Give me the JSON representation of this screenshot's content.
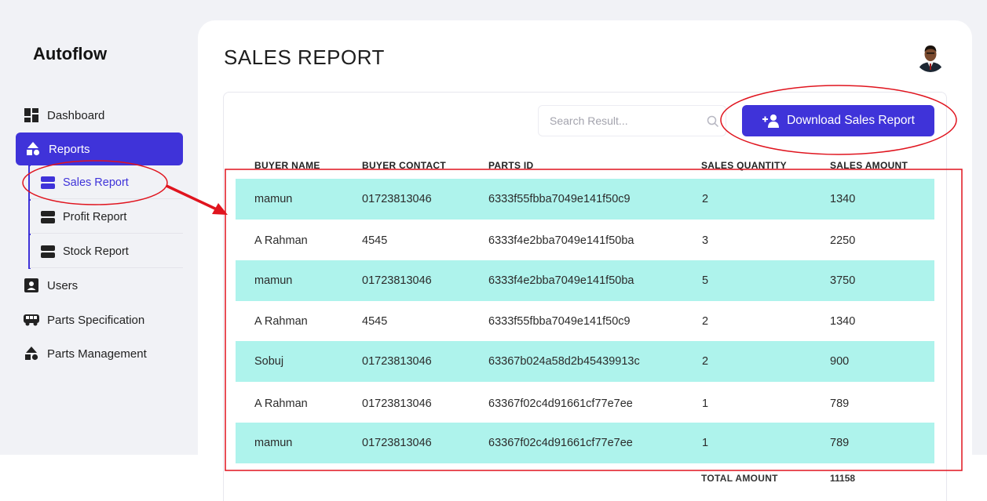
{
  "app": {
    "title": "Autoflow"
  },
  "sidebar": {
    "items": [
      {
        "label": "Dashboard",
        "icon": "dashboard-icon"
      },
      {
        "label": "Reports",
        "icon": "shapes-icon",
        "active": true
      },
      {
        "label": "Users",
        "icon": "user-card-icon"
      },
      {
        "label": "Parts Specification",
        "icon": "bus-icon"
      },
      {
        "label": "Parts Management",
        "icon": "shapes-icon"
      }
    ],
    "subitems": [
      {
        "label": "Sales Report",
        "icon": "report-icon",
        "active": true
      },
      {
        "label": "Profit Report",
        "icon": "report-icon"
      },
      {
        "label": "Stock Report",
        "icon": "report-icon"
      }
    ]
  },
  "page": {
    "title": "SALES REPORT"
  },
  "search": {
    "placeholder": "Search Result..."
  },
  "download_button": {
    "label": "Download Sales Report",
    "icon": "add-user-icon"
  },
  "table": {
    "headers": [
      "BUYER NAME",
      "BUYER CONTACT",
      "PARTS ID",
      "SALES QUANTITY",
      "SALES AMOUNT"
    ],
    "rows": [
      [
        "mamun",
        "01723813046",
        "6333f55fbba7049e141f50c9",
        "2",
        "1340"
      ],
      [
        "A Rahman",
        "4545",
        "6333f4e2bba7049e141f50ba",
        "3",
        "2250"
      ],
      [
        "mamun",
        "01723813046",
        "6333f4e2bba7049e141f50ba",
        "5",
        "3750"
      ],
      [
        "A Rahman",
        "4545",
        "6333f55fbba7049e141f50c9",
        "2",
        "1340"
      ],
      [
        "Sobuj",
        "01723813046",
        "63367b024a58d2b45439913c",
        "2",
        "900"
      ],
      [
        "A Rahman",
        "01723813046",
        "63367f02c4d91661cf77e7ee",
        "1",
        "789"
      ],
      [
        "mamun",
        "01723813046",
        "63367f02c4d91661cf77e7ee",
        "1",
        "789"
      ]
    ],
    "total_label": "TOTAL AMOUNT",
    "total_value": "11158"
  },
  "colors": {
    "accent": "#3f33d9",
    "row_highlight": "#aef3ec",
    "annotation": "#e0141e"
  }
}
